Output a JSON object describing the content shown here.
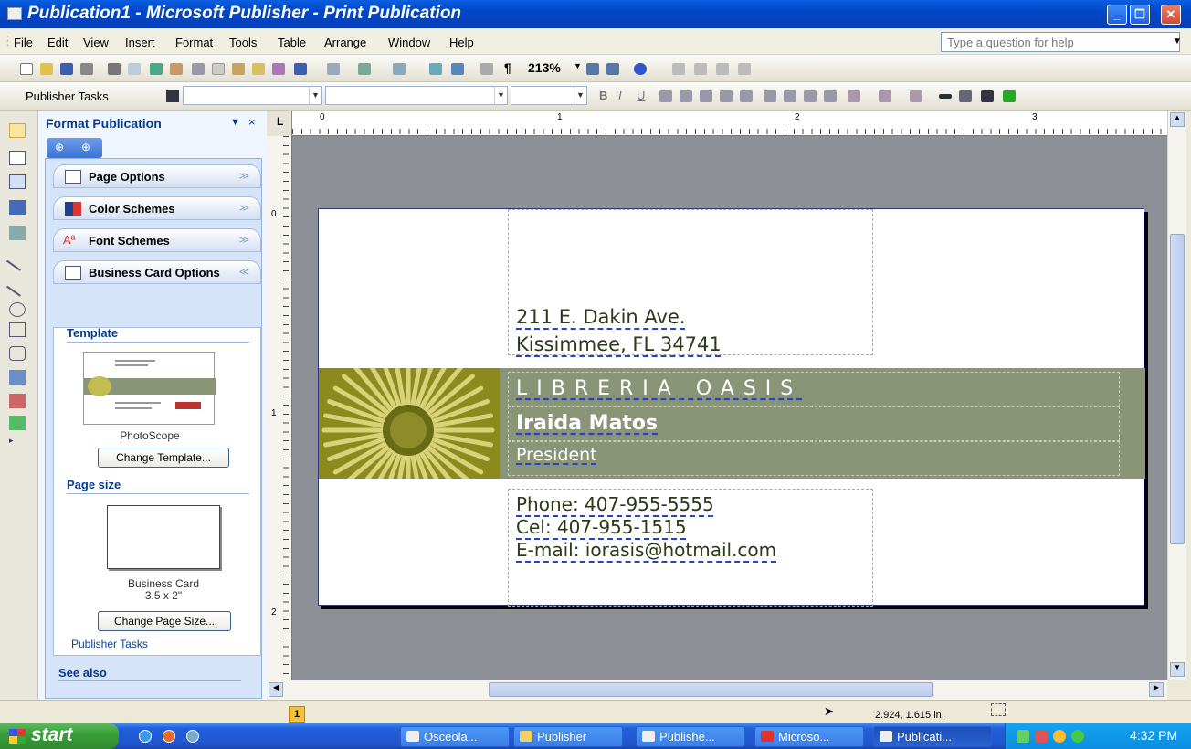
{
  "window": {
    "title": "Publication1 - Microsoft Publisher - Print Publication",
    "controls": [
      "minimize",
      "restore",
      "close"
    ]
  },
  "menubar": {
    "items": [
      "File",
      "Edit",
      "View",
      "Insert",
      "Format",
      "Tools",
      "Table",
      "Arrange",
      "Window",
      "Help"
    ],
    "help_placeholder": "Type a question for help"
  },
  "toolbar": {
    "zoom_value": "213%"
  },
  "formatting_toolbar": {
    "publisher_tasks_label": "Publisher Tasks",
    "style_value": "",
    "font_value": "",
    "size_value": ""
  },
  "task_pane": {
    "title": "Format Publication",
    "sections": [
      "Page Options",
      "Color Schemes",
      "Font Schemes",
      "Business Card Options"
    ],
    "template_heading": "Template",
    "template_name": "PhotoScope",
    "change_template_button": "Change Template...",
    "page_size_heading": "Page size",
    "page_size_name": "Business Card",
    "page_size_dims": "3.5 x 2\"",
    "change_page_size_button": "Change Page Size...",
    "see_also_heading": "See also",
    "see_also_link": "Publisher Tasks"
  },
  "rulers": {
    "horizontal_labels": [
      "0",
      "1",
      "2",
      "3"
    ],
    "vertical_labels": [
      "0",
      "1",
      "2"
    ],
    "corner_label": "L"
  },
  "card": {
    "address_line1": "211 E. Dakin Ave.",
    "address_line2": "Kissimmee, FL 34741",
    "company": "LIBRERIA OASIS",
    "name": "Iraida Matos",
    "title": "President",
    "phone": "Phone: 407-955-5555",
    "cel": "Cel: 407-955-1515",
    "email": "E-mail: iorasis@hotmail.com",
    "band_color": "#8a9577",
    "flower_color": "#b6ae33"
  },
  "statusbar": {
    "page_number": "1",
    "position": "2.924, 1.615 in."
  },
  "taskbar": {
    "start_label": "start",
    "tasks": [
      "Osceola...",
      "Publisher",
      "Publishe...",
      "Microso...",
      "Publicati..."
    ],
    "active_task_index": 4,
    "clock": "4:32 PM"
  }
}
